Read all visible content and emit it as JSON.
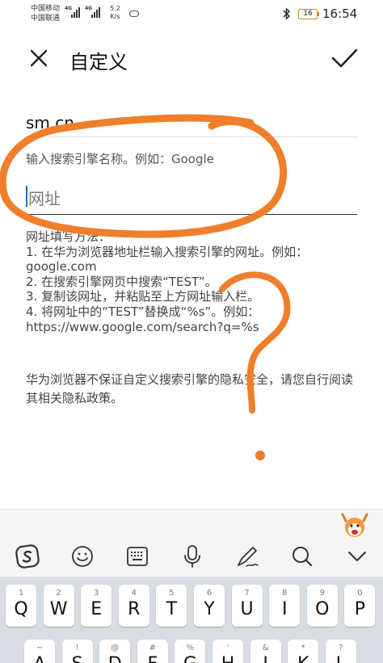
{
  "status_bar": {
    "carrier1": "中国移动",
    "carrier2": "中国联通",
    "net1": "4G",
    "net2": "4G",
    "speed_value": "5.2",
    "speed_unit": "K/s",
    "battery": "16",
    "time": "16:54"
  },
  "header": {
    "title": "自定义"
  },
  "form": {
    "name_value": "sm.cn",
    "name_hint": "输入搜索引擎名称。例如：Google",
    "url_placeholder": "网址"
  },
  "instructions": {
    "heading": "网址填写方法：",
    "line1": "1. 在华为浏览器地址栏输入搜索引擎的网址。例如：",
    "line1b": "google.com",
    "line2": "2. 在搜索引擎网页中搜索“TEST”。",
    "line3": "3. 复制该网址，并粘贴至上方网址输入栏。",
    "line4": "4. 将网址中的“TEST”替换成“%s”。例如：",
    "line4b": "https://www.google.com/search?q=%s"
  },
  "disclaimer": "华为浏览器不保证自定义搜索引擎的隐私安全，请您自行阅读其相关隐私政策。",
  "keyboard": {
    "toolbar_icons": [
      "sogou-logo-icon",
      "emoji-icon",
      "keyboard-icon",
      "microphone-icon",
      "handwriting-icon",
      "search-icon",
      "chevron-down-icon"
    ],
    "row1": [
      {
        "num": "1",
        "ch": "Q"
      },
      {
        "num": "2",
        "ch": "W"
      },
      {
        "num": "3",
        "ch": "E"
      },
      {
        "num": "4",
        "ch": "R"
      },
      {
        "num": "5",
        "ch": "T"
      },
      {
        "num": "6",
        "ch": "Y"
      },
      {
        "num": "7",
        "ch": "U"
      },
      {
        "num": "8",
        "ch": "I"
      },
      {
        "num": "9",
        "ch": "O"
      },
      {
        "num": "0",
        "ch": "P"
      }
    ],
    "row2": [
      {
        "num": "~",
        "ch": "A"
      },
      {
        "num": "!",
        "ch": "S"
      },
      {
        "num": "@",
        "ch": "D"
      },
      {
        "num": "#",
        "ch": "F"
      },
      {
        "num": "%",
        "ch": "G"
      },
      {
        "num": "'",
        "ch": "H"
      },
      {
        "num": "&",
        "ch": "J"
      },
      {
        "num": "*",
        "ch": "K"
      },
      {
        "num": "?",
        "ch": "L"
      }
    ]
  },
  "colors": {
    "scribble": "#f07e2a",
    "cursor": "#1e6ec8"
  }
}
